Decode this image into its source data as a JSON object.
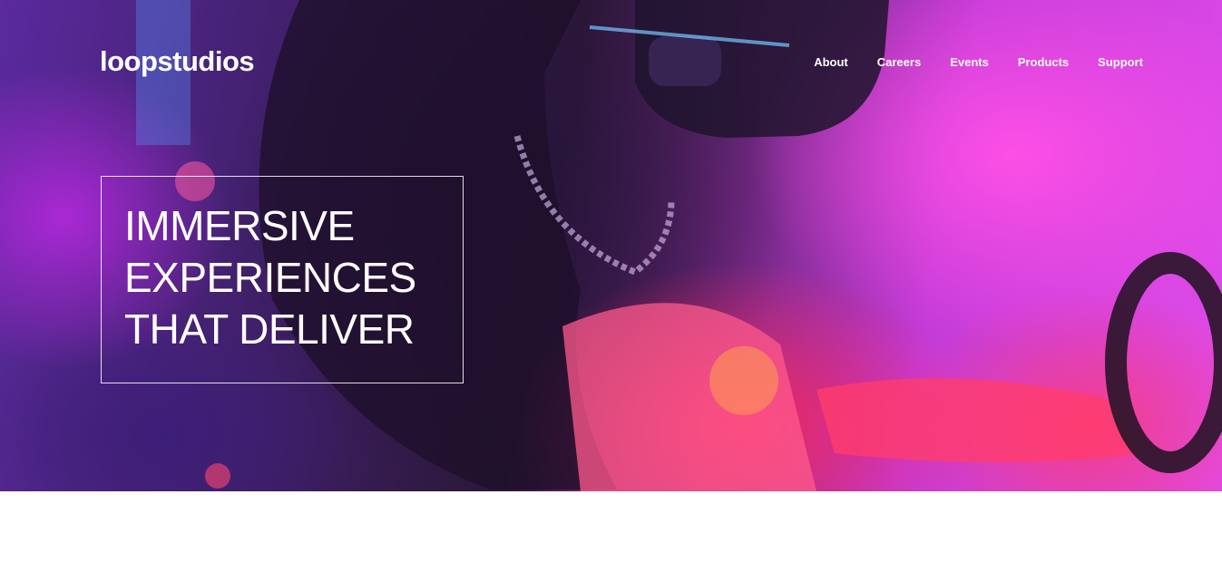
{
  "brand": {
    "logo_text": "loopstudios"
  },
  "nav": {
    "items": [
      {
        "label": "About"
      },
      {
        "label": "Careers"
      },
      {
        "label": "Events"
      },
      {
        "label": "Products"
      },
      {
        "label": "Support"
      }
    ]
  },
  "hero": {
    "headline_lines": [
      "IMMERSIVE",
      "EXPERIENCES",
      "THAT DELIVER"
    ],
    "image_description_icon": "vr-headset-photo"
  },
  "colors": {
    "overlay_magenta": "#e04bea",
    "overlay_purple": "#5a2a9e",
    "overlay_red": "#ff2860",
    "text": "#ffffff",
    "page_bg": "#ffffff"
  }
}
